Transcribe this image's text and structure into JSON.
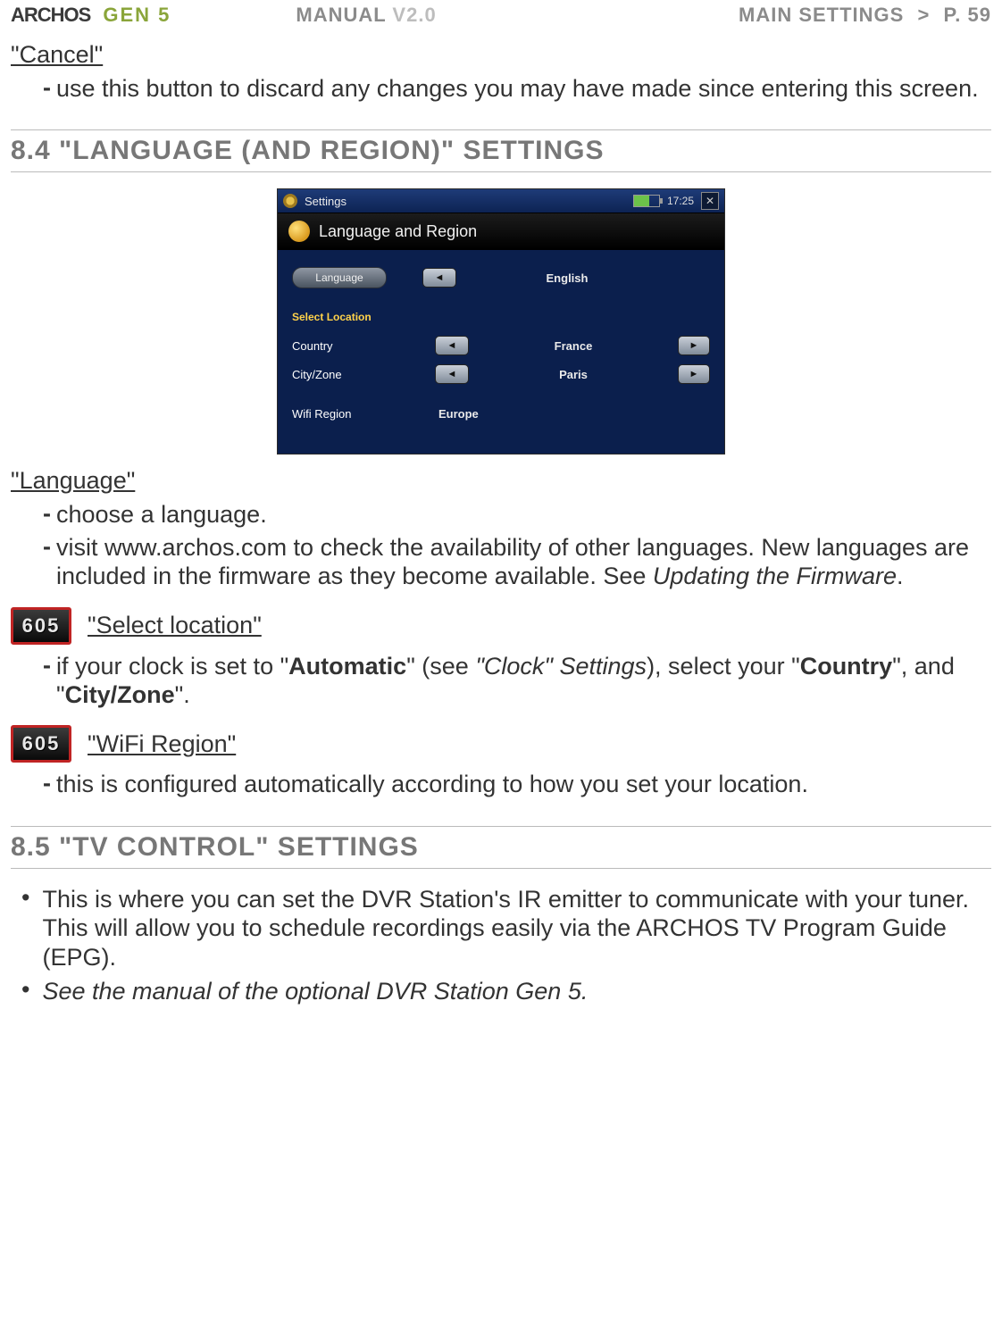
{
  "header": {
    "brand": "ARCHOS",
    "product_line": "GEN 5",
    "manual_label": "MANUAL",
    "manual_version": "V2.0",
    "breadcrumb_section": "MAIN SETTINGS",
    "breadcrumb_sep": ">",
    "page_label": "P. 59"
  },
  "cancel": {
    "title": "\"Cancel\"",
    "items": [
      "use this button to discard any changes you may have made since entering this screen."
    ]
  },
  "section_84": {
    "title": "8.4 \"LANGUAGE (AND REGION)\" SETTINGS"
  },
  "screenshot": {
    "titlebar_title": "Settings",
    "time": "17:25",
    "close_glyph": "✕",
    "panel_title": "Language and Region",
    "language_button": "Language",
    "language_value": "English",
    "select_location_label": "Select Location",
    "country_label": "Country",
    "country_value": "France",
    "cityzone_label": "City/Zone",
    "cityzone_value": "Paris",
    "wifi_region_label": "Wifi Region",
    "wifi_region_value": "Europe",
    "arrow_left": "◄",
    "arrow_right": "►"
  },
  "language_block": {
    "title": "\"Language\"",
    "item1": "choose a language.",
    "item2_pre": "visit www.archos.com to check the availability of other languages. New lan­guages are included in the firmware as they become available. See ",
    "item2_link": "Updating the Firmware",
    "item2_post": "."
  },
  "select_location_block": {
    "badge": "605",
    "title": "\"Select location\"",
    "item_pre": "if your clock is set to \"",
    "item_bold1": "Automatic",
    "item_mid1": "\" (see ",
    "item_italic": "\"Clock\" Settings",
    "item_mid2": "), select your \"",
    "item_bold2": "Country",
    "item_mid3": "\", and \"",
    "item_bold3": "City/Zone",
    "item_post": "\"."
  },
  "wifi_region_block": {
    "badge": "605",
    "title": "\"WiFi Region\"",
    "item": "this is configured automatically according to how you set your location."
  },
  "section_85": {
    "title": "8.5 \"TV CONTROL\" SETTINGS",
    "bullet1": "This is where you can set the DVR Station's IR emitter to communicate with your tuner. This will allow you to schedule recordings easily via the ARCHOS TV Program Guide (EPG).",
    "bullet2": "See the manual of the optional DVR Station Gen 5."
  }
}
